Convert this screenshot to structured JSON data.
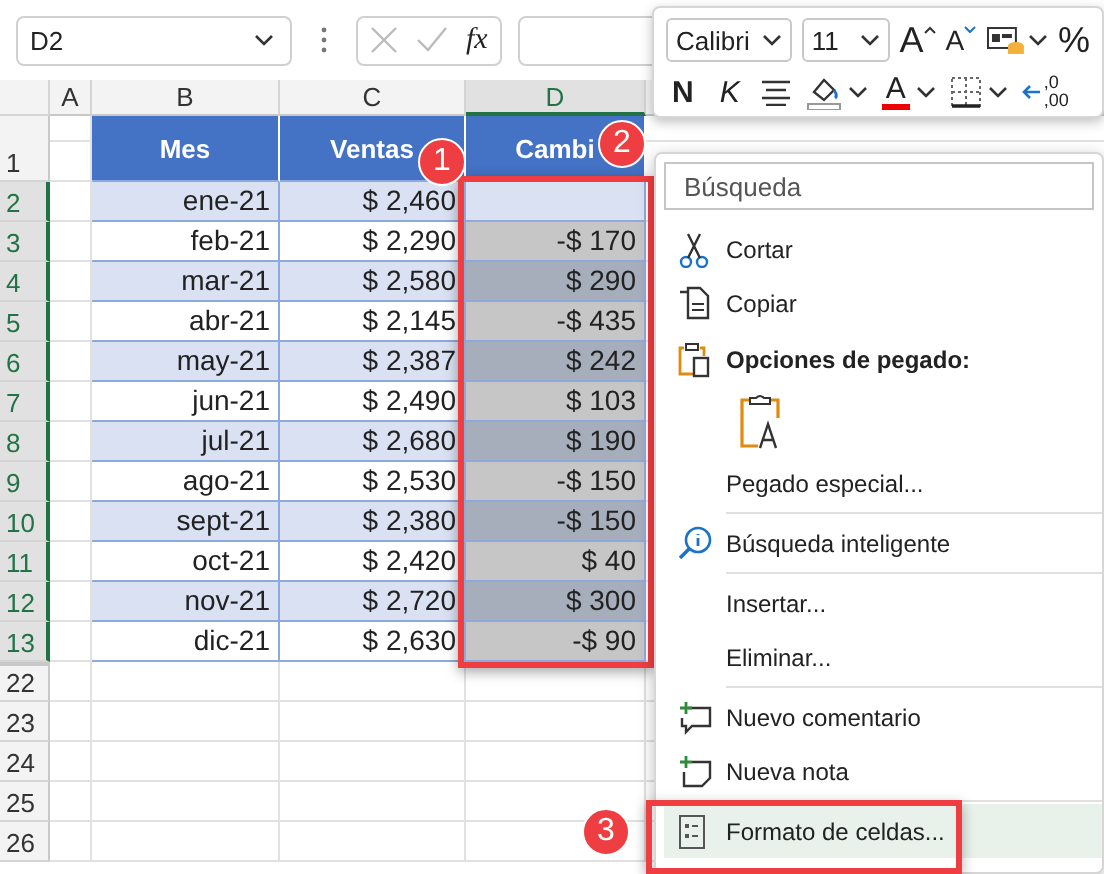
{
  "name_box": {
    "value": "D2"
  },
  "formula_bar": {
    "function_label": "fx"
  },
  "columns": [
    {
      "label": "A",
      "selected": false
    },
    {
      "label": "B",
      "selected": false
    },
    {
      "label": "C",
      "selected": false
    },
    {
      "label": "D",
      "selected": true
    }
  ],
  "header_row": {
    "row": "1",
    "cells": [
      "Mes",
      "Ventas",
      "Cambi"
    ]
  },
  "rows": [
    {
      "row": "2",
      "mes": "ene-21",
      "ventas": "$ 2,460",
      "banded": true,
      "selected": true,
      "active": true
    },
    {
      "row": "3",
      "mes": "feb-21",
      "ventas": "$ 2,290",
      "cambio": "-$ 170",
      "banded": false,
      "selected": true,
      "active": false
    },
    {
      "row": "4",
      "mes": "mar-21",
      "ventas": "$ 2,580",
      "cambio": "$ 290",
      "banded": true,
      "selected": true,
      "active": false
    },
    {
      "row": "5",
      "mes": "abr-21",
      "ventas": "$ 2,145",
      "cambio": "-$ 435",
      "banded": false,
      "selected": true,
      "active": false
    },
    {
      "row": "6",
      "mes": "may-21",
      "ventas": "$ 2,387",
      "cambio": "$ 242",
      "banded": true,
      "selected": true,
      "active": false
    },
    {
      "row": "7",
      "mes": "jun-21",
      "ventas": "$ 2,490",
      "cambio": "$ 103",
      "banded": false,
      "selected": true,
      "active": false
    },
    {
      "row": "8",
      "mes": "jul-21",
      "ventas": "$ 2,680",
      "cambio": "$ 190",
      "banded": true,
      "selected": true,
      "active": false
    },
    {
      "row": "9",
      "mes": "ago-21",
      "ventas": "$ 2,530",
      "cambio": "-$ 150",
      "banded": false,
      "selected": true,
      "active": false
    },
    {
      "row": "10",
      "mes": "sept-21",
      "ventas": "$ 2,380",
      "cambio": "-$ 150",
      "banded": true,
      "selected": true,
      "active": false
    },
    {
      "row": "11",
      "mes": "oct-21",
      "ventas": "$ 2,420",
      "cambio": "$ 40",
      "banded": false,
      "selected": true,
      "active": false
    },
    {
      "row": "12",
      "mes": "nov-21",
      "ventas": "$ 2,720",
      "cambio": "$ 300",
      "banded": true,
      "selected": true,
      "active": false
    },
    {
      "row": "13",
      "mes": "dic-21",
      "ventas": "$ 2,630",
      "cambio": "-$ 90",
      "banded": false,
      "selected": true,
      "active": false
    }
  ],
  "empty_rows": [
    "22",
    "23",
    "24",
    "25",
    "26"
  ],
  "mini_toolbar": {
    "font": "Calibri",
    "size": "11",
    "top_tools": [
      {
        "kind": "grow",
        "label": "A"
      },
      {
        "kind": "shrink",
        "label": "A"
      },
      {
        "kind": "styles"
      },
      {
        "kind": "text",
        "label": "%"
      }
    ],
    "bottom_tools": [
      {
        "kind": "bold",
        "label": "N"
      },
      {
        "kind": "italic",
        "label": "K"
      },
      {
        "kind": "align"
      },
      {
        "kind": "fill"
      },
      {
        "kind": "font-color",
        "label": "A"
      },
      {
        "kind": "borders"
      },
      {
        "kind": "decimal",
        "label": ",0",
        "sublabel": ",00"
      }
    ]
  },
  "context_menu": {
    "search": {
      "placeholder": "Búsqueda"
    },
    "items": [
      {
        "kind": "item",
        "label": "Cortar",
        "selected": false
      },
      {
        "kind": "item",
        "label": "Copiar",
        "selected": false
      },
      {
        "kind": "heading",
        "label": "Opciones de pegado:"
      },
      {
        "kind": "paste-option"
      },
      {
        "kind": "item",
        "label": "Pegado especial...",
        "selected": false
      },
      {
        "kind": "separator"
      },
      {
        "kind": "item",
        "label": "Búsqueda inteligente",
        "selected": false
      },
      {
        "kind": "separator"
      },
      {
        "kind": "item",
        "label": "Insertar...",
        "selected": false
      },
      {
        "kind": "item",
        "label": "Eliminar...",
        "selected": false
      },
      {
        "kind": "separator"
      },
      {
        "kind": "item",
        "label": "Nuevo comentario",
        "selected": false
      },
      {
        "kind": "item",
        "label": "Nueva nota",
        "selected": false
      },
      {
        "kind": "separator"
      },
      {
        "kind": "item",
        "label": "Formato de celdas...",
        "selected": true
      }
    ]
  },
  "callouts": [
    {
      "number": "1"
    },
    {
      "number": "2"
    },
    {
      "number": "3"
    }
  ]
}
